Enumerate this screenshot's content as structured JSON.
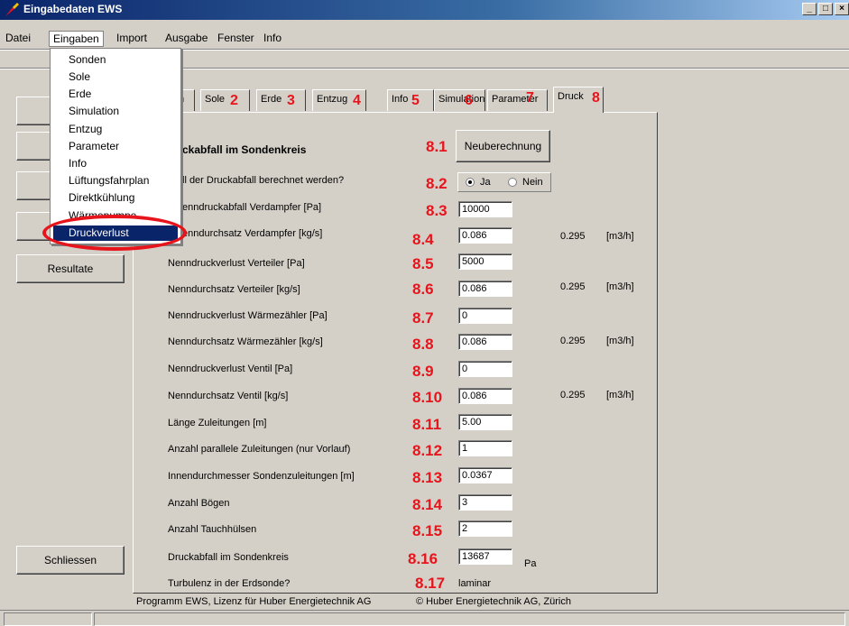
{
  "window": {
    "title": "Eingabedaten EWS",
    "buttons": [
      "_",
      "□",
      "×"
    ]
  },
  "menubar": [
    "Datei",
    "Eingaben",
    "Import",
    "Ausgabe",
    "Fenster",
    "Info"
  ],
  "dropdown": {
    "items": [
      "Sonden",
      "Sole",
      "Erde",
      "Simulation",
      "Entzug",
      "Parameter",
      "Info",
      "Lüftungsfahrplan",
      "Direktkühlung",
      "Wärmepumpe",
      "Druckverlust"
    ],
    "selected": "Druckverlust"
  },
  "left_buttons": {
    "resultate": "Resultate",
    "schliessen": "Schliessen"
  },
  "tabs": [
    {
      "label": "n",
      "num": "1"
    },
    {
      "label": "Sole",
      "num": "2"
    },
    {
      "label": "Erde",
      "num": "3"
    },
    {
      "label": "Entzug",
      "num": "4"
    },
    {
      "label": "Info",
      "num": "5"
    },
    {
      "label": "Simulation",
      "num": "6"
    },
    {
      "label": "Parameter",
      "num": "7"
    },
    {
      "label": "Druck",
      "num": "8"
    }
  ],
  "section_title": "ckabfall im Sondenkreis",
  "recalc_button": "Neuberechnung",
  "question": "ll der Druckabfall berechnet werden?",
  "radio": {
    "yes": "Ja",
    "no": "Nein",
    "selected": "yes"
  },
  "section_num": "8.1",
  "question_num": "8.2",
  "rows": [
    {
      "num": "8.3",
      "label": "enndruckabfall Verdampfer [Pa]",
      "value": "10000"
    },
    {
      "num": "8.4",
      "label": "enndurchsatz Verdampfer [kg/s]",
      "value": "0.086",
      "flow": "0.295",
      "unit": "[m3/h]"
    },
    {
      "num": "8.5",
      "label": "Nenndruckverlust Verteiler [Pa]",
      "value": "5000"
    },
    {
      "num": "8.6",
      "label": "Nenndurchsatz Verteiler [kg/s]",
      "value": "0.086",
      "flow": "0.295",
      "unit": "[m3/h]"
    },
    {
      "num": "8.7",
      "label": "Nenndruckverlust Wärmezähler [Pa]",
      "value": "0"
    },
    {
      "num": "8.8",
      "label": "Nenndurchsatz Wärmezähler [kg/s]",
      "value": "0.086",
      "flow": "0.295",
      "unit": "[m3/h]"
    },
    {
      "num": "8.9",
      "label": "Nenndruckverlust Ventil [Pa]",
      "value": "0"
    },
    {
      "num": "8.10",
      "label": "Nenndurchsatz Ventil [kg/s]",
      "value": "0.086",
      "flow": "0.295",
      "unit": "[m3/h]"
    },
    {
      "num": "8.11",
      "label": "Länge Zuleitungen [m]",
      "value": "5.00"
    },
    {
      "num": "8.12",
      "label": "Anzahl parallele Zuleitungen (nur Vorlauf)",
      "value": "1"
    },
    {
      "num": "8.13",
      "label": "Innendurchmesser Sondenzuleitungen [m]",
      "value": "0.0367"
    },
    {
      "num": "8.14",
      "label": "Anzahl Bögen",
      "value": "3"
    },
    {
      "num": "8.15",
      "label": "Anzahl Tauchhülsen",
      "value": "2"
    },
    {
      "num": "8.16",
      "label": "Druckabfall im Sondenkreis",
      "value": "13687",
      "unit": "Pa"
    },
    {
      "num": "8.17",
      "label": "Turbulenz in der Erdsonde?",
      "value": "laminar"
    }
  ],
  "footer": {
    "left": "Programm EWS, Lizenz für Huber Energietechnik AG",
    "right": "© Huber Energietechnik AG, Zürich"
  },
  "colors": {
    "accent_red": "#e8141c",
    "selection": "#0a246a"
  }
}
